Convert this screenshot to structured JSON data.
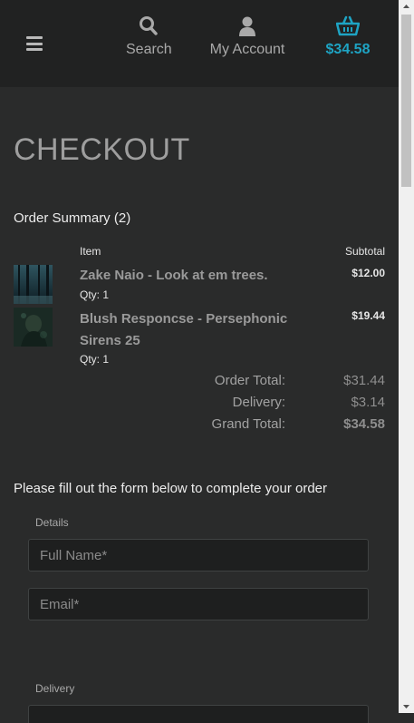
{
  "header": {
    "search_label": "Search",
    "account_label": "My Account",
    "cart_total": "$34.58",
    "colors": {
      "background": "#212222",
      "accent": "#1ea4c4"
    },
    "icons": [
      "menu-icon",
      "search-icon",
      "user-icon",
      "basket-icon"
    ]
  },
  "page": {
    "title": "CHECKOUT",
    "summary_heading": "Order Summary (2)",
    "col_item": "Item",
    "col_subtotal": "Subtotal"
  },
  "items": [
    {
      "name": "Zake Naio - Look at em trees.",
      "qty": "Qty: 1",
      "price": "$12.00"
    },
    {
      "name": "Blush Responcse - Persephonic Sirens 25",
      "qty": "Qty: 1",
      "price": "$19.44"
    }
  ],
  "totals": {
    "order_total_label": "Order Total:",
    "order_total": "$31.44",
    "delivery_label": "Delivery:",
    "delivery": "$3.14",
    "grand_total_label": "Grand Total:",
    "grand_total": "$34.58"
  },
  "form": {
    "intro": "Please fill out the form below to complete your order",
    "details_label": "Details",
    "full_name_placeholder": "Full Name*",
    "email_placeholder": "Email*",
    "delivery_label": "Delivery"
  }
}
